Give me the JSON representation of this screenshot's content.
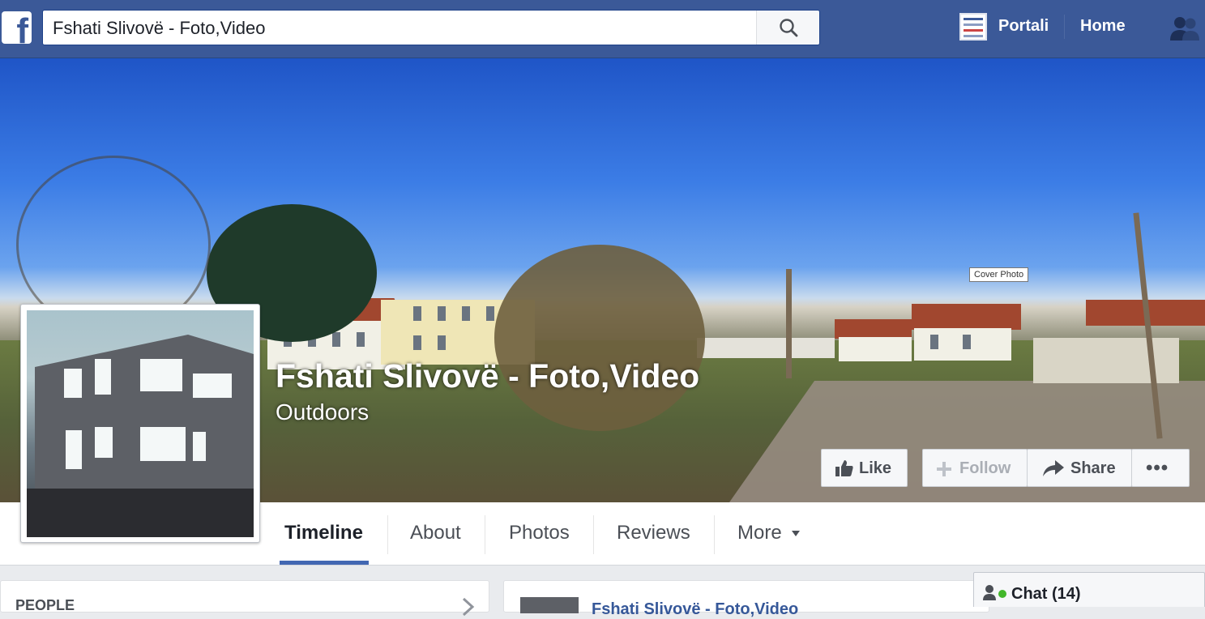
{
  "topbar": {
    "logo_letter": "f",
    "search_value": "Fshati Slivovë - Foto,Video",
    "nav": {
      "portali": "Portali",
      "home": "Home"
    }
  },
  "cover": {
    "tooltip": "Cover Photo",
    "page_name": "Fshati Slivovë - Foto,Video",
    "category": "Outdoors",
    "buttons": {
      "like": "Like",
      "follow": "Follow",
      "share": "Share",
      "more": "•••"
    }
  },
  "tabs": {
    "timeline": "Timeline",
    "about": "About",
    "photos": "Photos",
    "reviews": "Reviews",
    "more": "More"
  },
  "sidebar": {
    "people_label": "PEOPLE"
  },
  "feed": {
    "post_author": "Fshati Slivovë - Foto,Video"
  },
  "chat": {
    "label": "Chat (14)"
  },
  "colors": {
    "brand_blue": "#3b5998",
    "tab_underline": "#4267b2",
    "online_green": "#42b72a"
  },
  "icons": [
    "facebook-logo-icon",
    "search-icon",
    "portali-thumbnail-icon",
    "friend-requests-icon",
    "thumbs-up-icon",
    "plus-icon",
    "share-arrow-icon",
    "ellipsis-icon",
    "caret-down-icon",
    "chevron-right-icon",
    "person-icon"
  ]
}
